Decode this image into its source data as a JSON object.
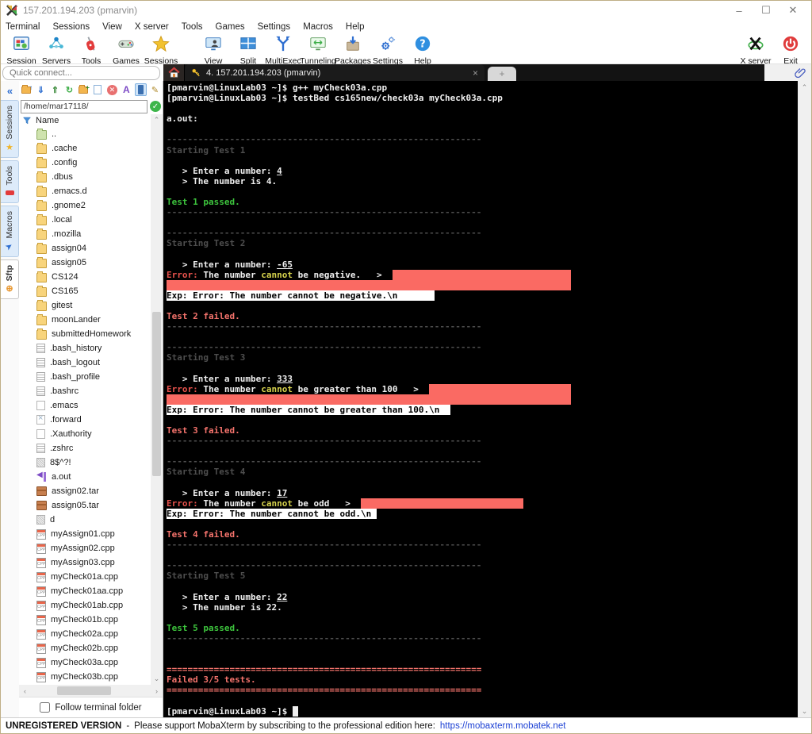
{
  "window": {
    "title": "157.201.194.203 (pmarvin)",
    "controls": {
      "minimize": "–",
      "maximize": "❐",
      "close": "✕"
    }
  },
  "menu": {
    "items": [
      "Terminal",
      "Sessions",
      "View",
      "X server",
      "Tools",
      "Games",
      "Settings",
      "Macros",
      "Help"
    ]
  },
  "toolbar": {
    "left_group": [
      {
        "label": "Session",
        "icon": "session-icon"
      },
      {
        "label": "Servers",
        "icon": "servers-icon"
      },
      {
        "label": "Tools",
        "icon": "tools-icon"
      },
      {
        "label": "Games",
        "icon": "games-icon"
      },
      {
        "label": "Sessions",
        "icon": "sessions-star-icon"
      }
    ],
    "mid_group": [
      {
        "label": "View",
        "icon": "view-icon"
      },
      {
        "label": "Split",
        "icon": "split-icon"
      },
      {
        "label": "MultiExec",
        "icon": "multiexec-icon"
      },
      {
        "label": "Tunneling",
        "icon": "tunneling-icon"
      },
      {
        "label": "Packages",
        "icon": "packages-icon"
      },
      {
        "label": "Settings",
        "icon": "settings-icon"
      },
      {
        "label": "Help",
        "icon": "help-icon"
      }
    ],
    "right_group": [
      {
        "label": "X server",
        "icon": "xserver-icon"
      },
      {
        "label": "Exit",
        "icon": "exit-icon"
      }
    ]
  },
  "quick_connect": {
    "placeholder": "Quick connect..."
  },
  "tab_bar": {
    "active_tab": "4. 157.201.194.203 (pmarvin)",
    "close_glyph": "×",
    "new_tab_glyph": "+"
  },
  "sidebar": {
    "collapse_glyph": "«",
    "tabs": [
      {
        "label": "Sessions",
        "icon": "star-icon",
        "active": false
      },
      {
        "label": "Tools",
        "icon": "knife-icon",
        "active": false
      },
      {
        "label": "Macros",
        "icon": "plane-icon",
        "active": false
      },
      {
        "label": "Sftp",
        "icon": "globe-icon",
        "active": true
      }
    ],
    "mini_toolbar": [
      "parent-folder-icon",
      "download-icon",
      "upload-icon",
      "refresh-icon",
      "new-folder-icon",
      "new-file-icon",
      "delete-icon",
      "rename-icon",
      "sync-browser-icon",
      "edit-icon"
    ],
    "sftp": {
      "path": "/home/mar17118/",
      "header": "Name",
      "items": [
        {
          "name": "..",
          "type": "folder-up"
        },
        {
          "name": ".cache",
          "type": "folder"
        },
        {
          "name": ".config",
          "type": "folder"
        },
        {
          "name": ".dbus",
          "type": "folder"
        },
        {
          "name": ".emacs.d",
          "type": "folder"
        },
        {
          "name": ".gnome2",
          "type": "folder"
        },
        {
          "name": ".local",
          "type": "folder"
        },
        {
          "name": ".mozilla",
          "type": "folder"
        },
        {
          "name": "assign04",
          "type": "folder"
        },
        {
          "name": "assign05",
          "type": "folder"
        },
        {
          "name": "CS124",
          "type": "folder"
        },
        {
          "name": "CS165",
          "type": "folder"
        },
        {
          "name": "gitest",
          "type": "folder"
        },
        {
          "name": "moonLander",
          "type": "folder"
        },
        {
          "name": "submittedHomework",
          "type": "folder"
        },
        {
          "name": ".bash_history",
          "type": "textfile"
        },
        {
          "name": ".bash_logout",
          "type": "textfile"
        },
        {
          "name": ".bash_profile",
          "type": "textfile"
        },
        {
          "name": ".bashrc",
          "type": "textfile"
        },
        {
          "name": ".emacs",
          "type": "file"
        },
        {
          "name": ".forward",
          "type": "file-x"
        },
        {
          "name": ".Xauthority",
          "type": "file"
        },
        {
          "name": ".zshrc",
          "type": "textfile"
        },
        {
          "name": "8$^?!",
          "type": "binary"
        },
        {
          "name": "a.out",
          "type": "executable"
        },
        {
          "name": "assign02.tar",
          "type": "archive"
        },
        {
          "name": "assign05.tar",
          "type": "archive"
        },
        {
          "name": "d",
          "type": "binary"
        },
        {
          "name": "myAssign01.cpp",
          "type": "cpp"
        },
        {
          "name": "myAssign02.cpp",
          "type": "cpp"
        },
        {
          "name": "myAssign03.cpp",
          "type": "cpp"
        },
        {
          "name": "myCheck01a.cpp",
          "type": "cpp"
        },
        {
          "name": "myCheck01aa.cpp",
          "type": "cpp"
        },
        {
          "name": "myCheck01ab.cpp",
          "type": "cpp"
        },
        {
          "name": "myCheck01b.cpp",
          "type": "cpp"
        },
        {
          "name": "myCheck02a.cpp",
          "type": "cpp"
        },
        {
          "name": "myCheck02b.cpp",
          "type": "cpp"
        },
        {
          "name": "myCheck03a.cpp",
          "type": "cpp"
        },
        {
          "name": "myCheck03b.cpp",
          "type": "cpp"
        },
        {
          "name": "",
          "type": "binary"
        }
      ],
      "follow_label": "Follow terminal folder"
    }
  },
  "terminal": {
    "colors": {
      "background": "#000000",
      "default_text": "#efefef",
      "dim": "#4e4e4e",
      "pass_green": "#3dc43d",
      "error_red": "#e8524c",
      "warn_yellow": "#d6d24c",
      "fail_salmon": "#f4736c",
      "diff_highlight_bg": "#fa6a63",
      "expected_inverse_bg": "#ffffff"
    },
    "lines": [
      [
        [
          "w",
          "[pmarvin@LinuxLab03 ~]$ g++ myCheck03a.cpp"
        ]
      ],
      [
        [
          "w",
          "[pmarvin@LinuxLab03 ~]$ testBed cs165new/check03a myCheck03a.cpp"
        ]
      ],
      [],
      [
        [
          "w",
          "a.out:"
        ]
      ],
      [],
      [
        [
          "d",
          "------------------------------------------------------------"
        ]
      ],
      [
        [
          "d",
          "Starting Test 1"
        ]
      ],
      [],
      [
        [
          "w",
          "   > Enter a number: "
        ],
        [
          "u",
          "4"
        ]
      ],
      [
        [
          "w",
          "   > The number is 4."
        ]
      ],
      [],
      [
        [
          "g",
          "Test 1 passed."
        ]
      ],
      [
        [
          "d",
          "------------------------------------------------------------"
        ]
      ],
      [],
      [
        [
          "d",
          "------------------------------------------------------------"
        ]
      ],
      [
        [
          "d",
          "Starting Test 2"
        ]
      ],
      [],
      [
        [
          "w",
          "   > Enter a number: "
        ],
        [
          "u",
          "-65"
        ]
      ],
      [
        [
          "r",
          "Error:"
        ],
        [
          "w",
          " The number "
        ],
        [
          "y",
          "cannot"
        ],
        [
          "w",
          " be negative.   >  "
        ],
        [
          "hl",
          34
        ]
      ],
      [
        [
          "hl",
          77
        ]
      ],
      [
        [
          "inv",
          "Exp: Error: The number cannot be negative.\\n       "
        ]
      ],
      [],
      [
        [
          "r2",
          "Test 2 failed."
        ]
      ],
      [
        [
          "d",
          "------------------------------------------------------------"
        ]
      ],
      [],
      [
        [
          "d",
          "------------------------------------------------------------"
        ]
      ],
      [
        [
          "d",
          "Starting Test 3"
        ]
      ],
      [],
      [
        [
          "w",
          "   > Enter a number: "
        ],
        [
          "u",
          "333"
        ]
      ],
      [
        [
          "r",
          "Error:"
        ],
        [
          "w",
          " The number "
        ],
        [
          "y",
          "cannot"
        ],
        [
          "w",
          " be greater than 100   >  "
        ],
        [
          "hl",
          27
        ]
      ],
      [
        [
          "hl",
          77
        ]
      ],
      [
        [
          "inv",
          "Exp: Error: The number cannot be greater than 100.\\n  "
        ]
      ],
      [],
      [
        [
          "r2",
          "Test 3 failed."
        ]
      ],
      [
        [
          "d",
          "------------------------------------------------------------"
        ]
      ],
      [],
      [
        [
          "d",
          "------------------------------------------------------------"
        ]
      ],
      [
        [
          "d",
          "Starting Test 4"
        ]
      ],
      [],
      [
        [
          "w",
          "   > Enter a number: "
        ],
        [
          "u",
          "17"
        ]
      ],
      [
        [
          "r",
          "Error:"
        ],
        [
          "w",
          " The number "
        ],
        [
          "y",
          "cannot"
        ],
        [
          "w",
          " be odd   >  "
        ],
        [
          "hl",
          31
        ]
      ],
      [
        [
          "inv",
          "Exp: Error: The number cannot be odd.\\n "
        ]
      ],
      [],
      [
        [
          "r2",
          "Test 4 failed."
        ]
      ],
      [
        [
          "d",
          "------------------------------------------------------------"
        ]
      ],
      [],
      [
        [
          "d",
          "------------------------------------------------------------"
        ]
      ],
      [
        [
          "d",
          "Starting Test 5"
        ]
      ],
      [],
      [
        [
          "w",
          "   > Enter a number: "
        ],
        [
          "u",
          "22"
        ]
      ],
      [
        [
          "w",
          "   > The number is 22."
        ]
      ],
      [],
      [
        [
          "g",
          "Test 5 passed."
        ]
      ],
      [
        [
          "d",
          "------------------------------------------------------------"
        ]
      ],
      [],
      [],
      [
        [
          "r2",
          "============================================================"
        ]
      ],
      [
        [
          "r2",
          "Failed 3/5 tests."
        ]
      ],
      [
        [
          "r2",
          "============================================================"
        ]
      ],
      [],
      [
        [
          "w",
          "[pmarvin@LinuxLab03 ~]$ "
        ],
        [
          "cur",
          " "
        ]
      ]
    ]
  },
  "statusbar": {
    "version": "UNREGISTERED VERSION",
    "separator": "-",
    "message": "Please support MobaXterm by subscribing to the professional edition here:",
    "link": "https://mobaxterm.mobatek.net"
  }
}
